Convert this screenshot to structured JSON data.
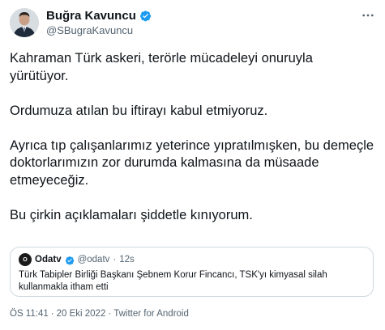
{
  "author": {
    "display_name": "Buğra Kavuncu",
    "handle": "@SBugraKavuncu",
    "verified_color": "#1d9bf0"
  },
  "menu_icon": "more-horizontal-icon",
  "tweet_paragraphs": [
    "Kahraman Türk askeri, terörle mücadeleyi onuruyla yürütüyor.",
    "Ordumuza atılan bu iftirayı kabul etmiyoruz.",
    "Ayrıca tıp çalışanlarımız yeterince yıpratılmışken, bu demeçle doktorlarımızın zor durumda kalmasına da müsaade etmeyeceğiz.",
    "Bu çirkin açıklamaları şiddetle kınıyorum."
  ],
  "quoted_tweet": {
    "avatar_text": "O",
    "display_name": "Odatv",
    "handle": "@odatv",
    "separator": "·",
    "time": "12s",
    "text": "Türk Tabipler Birliği Başkanı Şebnem Korur Fincancı, TSK'yı kimyasal silah kullanmakla itham etti"
  },
  "meta": {
    "time": "ÖS 11:41",
    "date": "20 Eki 2022",
    "source": "Twitter for Android",
    "separator": "·"
  }
}
